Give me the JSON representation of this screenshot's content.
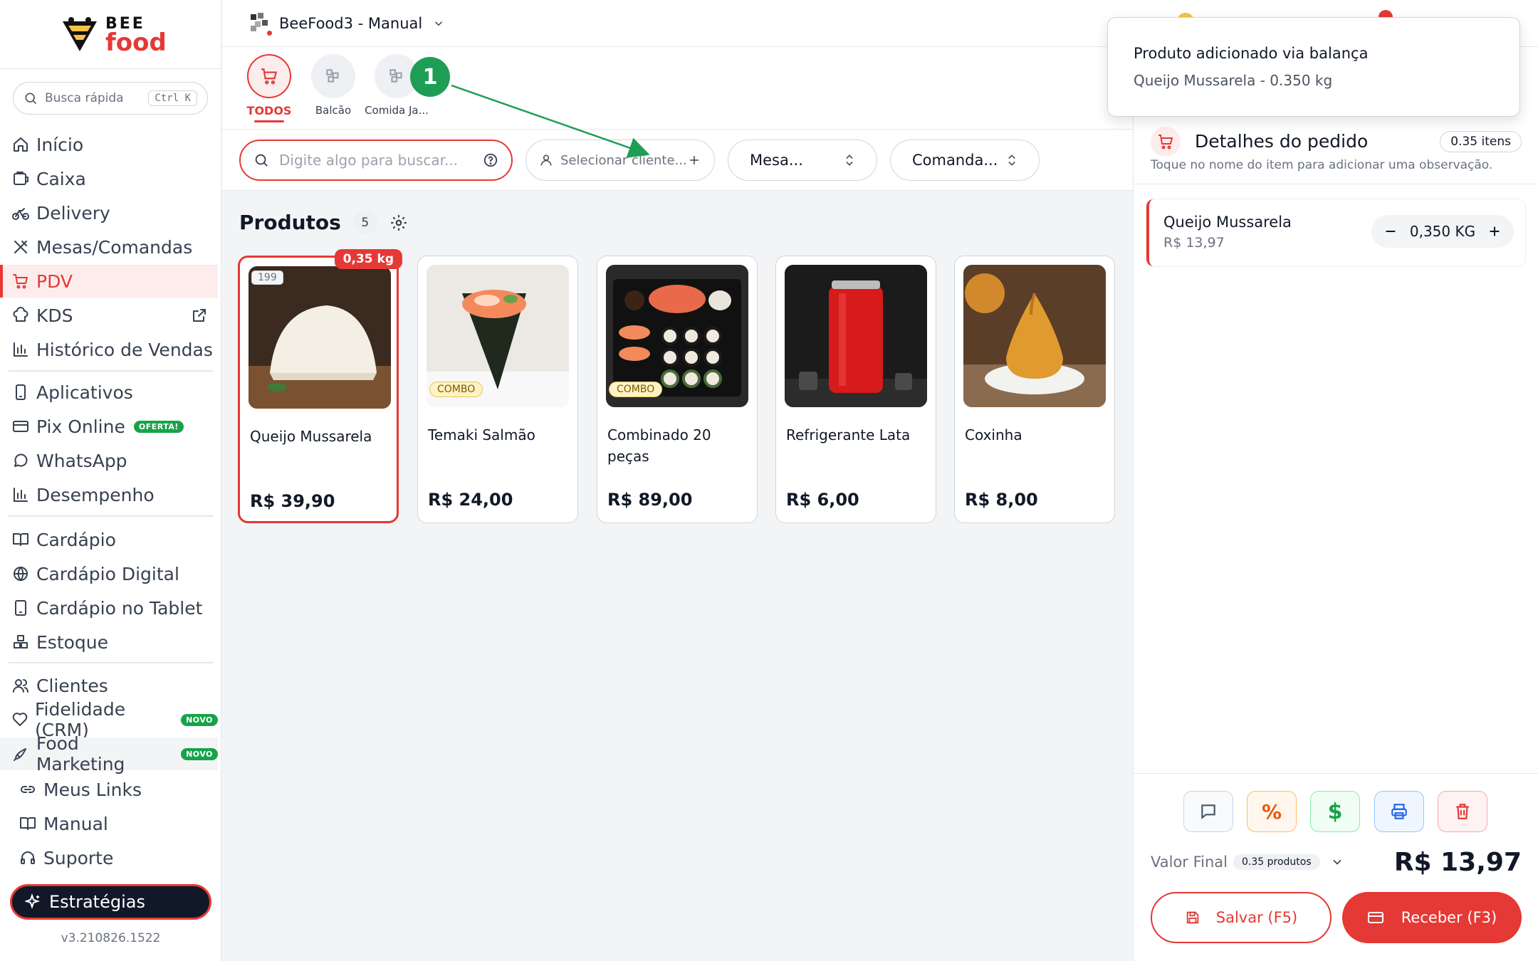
{
  "brand": {
    "top": "BEE",
    "bottom": "food"
  },
  "quick_search": {
    "label": "Busca rápida",
    "shortcut": "Ctrl K"
  },
  "nav": {
    "inicio": "Início",
    "caixa": "Caixa",
    "delivery": "Delivery",
    "mesas": "Mesas/Comandas",
    "pdv": "PDV",
    "kds": "KDS",
    "historico": "Histórico de Vendas",
    "aplicativos": "Aplicativos",
    "pix": "Pix Online",
    "pix_badge": "OFERTA!",
    "whatsapp": "WhatsApp",
    "desempenho": "Desempenho",
    "cardapio": "Cardápio",
    "cardapio_digital": "Cardápio Digital",
    "cardapio_tablet": "Cardápio no Tablet",
    "estoque": "Estoque",
    "clientes": "Clientes",
    "fidelidade": "Fidelidade (CRM)",
    "fidelidade_badge": "NOVO",
    "food_marketing": "Food Marketing",
    "food_marketing_badge": "NOVO",
    "meus_links": "Meus Links",
    "manual": "Manual",
    "suporte": "Suporte"
  },
  "strategies_button": "Estratégias",
  "version": "v3.210826.1522",
  "store": {
    "name": "BeeFood3 - Manual"
  },
  "categories": [
    {
      "label": "TODOS"
    },
    {
      "label": "Balcão"
    },
    {
      "label": "Comida Ja..."
    }
  ],
  "step_marker": "1",
  "filters": {
    "search_placeholder": "Digite algo para buscar...",
    "client_placeholder": "Selecionar cliente...",
    "mesa": "Mesa...",
    "comanda": "Comanda..."
  },
  "products_header": {
    "title": "Produtos",
    "count": "5"
  },
  "products": [
    {
      "name": "Queijo Mussarela",
      "price": "R$ 39,90",
      "code": "199",
      "weight": "0,35 kg"
    },
    {
      "name": "Temaki Salmão",
      "price": "R$ 24,00",
      "tag": "COMBO"
    },
    {
      "name": "Combinado 20 peças",
      "price": "R$ 89,00",
      "tag": "COMBO"
    },
    {
      "name": "Refrigerante Lata",
      "price": "R$ 6,00"
    },
    {
      "name": "Coxinha",
      "price": "R$ 8,00"
    }
  ],
  "toast": {
    "title": "Produto adicionado via balança",
    "message": "Queijo Mussarela - 0.350 kg"
  },
  "order": {
    "title": "Detalhes do pedido",
    "items_badge": "0.35 itens",
    "hint": "Toque no nome do item para adicionar uma observação.",
    "items": [
      {
        "name": "Queijo Mussarela",
        "price": "R$ 13,97",
        "qty": "0,350 KG"
      }
    ],
    "final_label": "Valor Final",
    "products_badge": "0.35 produtos",
    "total": "R$ 13,97",
    "save_button": "Salvar (F5)",
    "receive_button": "Receber (F3)"
  },
  "colors": {
    "primary": "#e53935",
    "success": "#1e9e55",
    "combo": "#e6c45a"
  }
}
